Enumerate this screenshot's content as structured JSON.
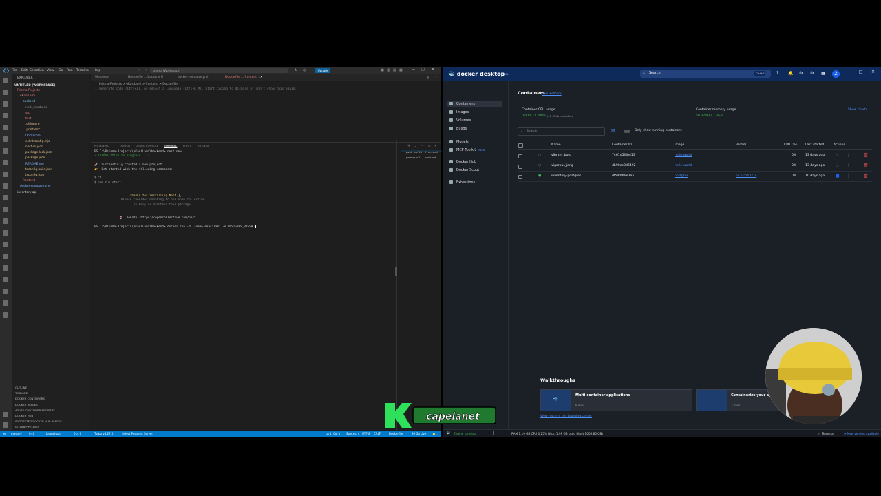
{
  "vscode": {
    "menu": [
      "File",
      "Edit",
      "Selection",
      "View",
      "Go",
      "Run",
      "Terminal",
      "Help"
    ],
    "command_center": "prisma [Workspace]",
    "update_label": "Update",
    "explorer_title": "EXPLORER",
    "workspace_title": "UNTITLED (WORKSPACE)",
    "tree": [
      "Prisma Projects",
      "eKasiLami",
      "backend",
      "node_modules",
      "src",
      "test",
      ".gitignore",
      ".prettierrc",
      "Dockerfile",
      "eslint.config.mjs",
      "nest-cli.json",
      "package-lock.json",
      "package.json",
      "README.md",
      "tsconfig.build.json",
      "tsconfig.json",
      "frontend",
      "docker-compose.yml",
      "inventory-api"
    ],
    "outline_sections": [
      "OUTLINE",
      "TIMELINE",
      "DOCKER CONTAINERS",
      "DOCKER IMAGES",
      "AZURE CONTAINER REGISTRY",
      "DOCKER HUB",
      "SUGGESTED DOCKER HUB IMAGES",
      "GITLAB PIPELINES"
    ],
    "tabs": [
      "Welcome",
      "Dockerfile .../backend U",
      "docker-compose.yml",
      "Dockerfile .../frontend 1"
    ],
    "breadcrumb": "Prisma-Projects > eKasiLami > frontend > Dockerfile",
    "editor_hint": "Generate code (Ctrl+I), or select a language (Ctrl+K M). Start typing to dismiss or don't show this again.",
    "panel_tabs": [
      "PROBLEMS",
      "OUTPUT",
      "DEBUG CONSOLE",
      "TERMINAL",
      "PORTS",
      "GITLENS"
    ],
    "terminal_lines": [
      "PS C:\\Prisma-Projects\\eKasiLami\\backend> nest new .",
      "✓ Installation in progress... ☕",
      "",
      "🚀  Successfully created a new project",
      "👉  Get started with the following commands:",
      "",
      "$ cd .",
      "$ npm run start",
      "",
      "",
      "                    Thanks for installing Nest 🙏",
      "               Please consider donating to our open collective",
      "                      to help us maintain this package.",
      "",
      "",
      "              🍷  Donate: https://opencollective.com/nest",
      "",
      "PS C:\\Prisma-Projects\\eKasiLami\\backend> docker run -d --name ekasilami -e POSTGRES_PASSW"
    ],
    "terminal_list": [
      "pwsh build  frontend",
      "powershell  backend"
    ],
    "status_left": [
      "master*",
      "0△0",
      "Launchpad",
      "0 ⚠ 0",
      "Turbo v4.27.0",
      "Select Postgres Server"
    ],
    "status_right": [
      "Ln 1, Col 1",
      "Spaces: 4",
      "UTF-8",
      "CRLF",
      "Dockerfile",
      "99 Go Live"
    ]
  },
  "docker": {
    "app_name": "docker desktop",
    "plan": "PERSONAL",
    "search_placeholder": "Search",
    "search_shortcut": "Ctrl+K",
    "nav": [
      "Containers",
      "Images",
      "Volumes",
      "Builds",
      "Models",
      "MCP Toolkit",
      "Docker Hub",
      "Docker Scout",
      "Extensions"
    ],
    "mcp_badge": "BETA",
    "page_title": "Containers",
    "feedback_link": "Give feedback",
    "cpu_label": "Container CPU usage",
    "cpu_value": "0.00% / 1200%",
    "cpu_note": "(12 CPUs available)",
    "mem_label": "Container memory usage",
    "mem_value": "59.37MB / 7.4GB",
    "show_charts": "Show charts",
    "table_search": "Search",
    "only_running": "Only show running containers",
    "columns": [
      "Name",
      "Container ID",
      "Image",
      "Port(s)",
      "CPU (%)",
      "Last started",
      "Actions"
    ],
    "rows": [
      {
        "name": "vibrant_borg",
        "id": "7461d5f8b413",
        "image": "hello-world",
        "ports": "",
        "cpu": "0%",
        "started": "13 days ago",
        "running": false
      },
      {
        "name": "vigorous_jang",
        "id": "db90ce8d6492",
        "image": "hello-world",
        "ports": "",
        "cpu": "0%",
        "started": "13 days ago",
        "running": false
      },
      {
        "name": "inventory-postgres",
        "id": "df5409f9e3a5",
        "image": "postgres",
        "ports": "5433:5432 ↗",
        "cpu": "0%",
        "started": "10 days ago",
        "running": true
      }
    ],
    "walkthroughs_title": "Walkthroughs",
    "walkthroughs": [
      {
        "title": "Multi-container applications",
        "time": "8 mins"
      },
      {
        "title": "Containerize your app",
        "time": "3 mins"
      }
    ],
    "learning_link": "View more in the Learning center",
    "engine_status": "Engine running",
    "resources": "RAM 1.19 GB  CPU 0.25%  Disk: 1.99 GB used (limit 1006.85 GB)",
    "terminal_label": "Terminal",
    "new_version": "New version available"
  },
  "overlay": {
    "logo_text": "capelanet"
  },
  "colors": {
    "vscode_blue": "#007acc",
    "docker_blue": "#1d63ed",
    "running_green": "#3fb950",
    "delete_red": "#e5534b"
  }
}
